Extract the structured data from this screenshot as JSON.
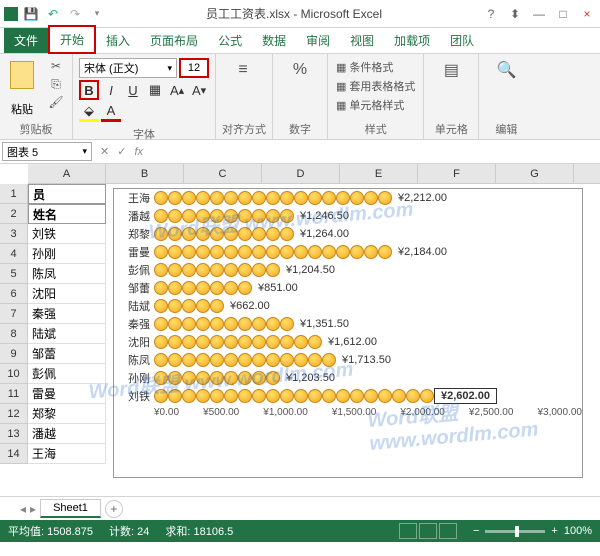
{
  "window": {
    "title": "员工工资表.xlsx - Microsoft Excel"
  },
  "tabs": {
    "file": "文件",
    "home": "开始",
    "insert": "插入",
    "page_layout": "页面布局",
    "formulas": "公式",
    "data": "数据",
    "review": "审阅",
    "view": "视图",
    "addins": "加载项",
    "team": "团队"
  },
  "ribbon": {
    "paste": "粘贴",
    "clipboard": "剪贴板",
    "font_name": "宋体 (正文)",
    "font_size": "12",
    "font_group": "字体",
    "align": "对齐方式",
    "number": "数字",
    "cond_format": "条件格式",
    "table_format": "套用表格格式",
    "cell_styles": "单元格样式",
    "styles": "样式",
    "cells": "单元格",
    "editing": "编辑"
  },
  "namebox": "图表 5",
  "columns": [
    "A",
    "B",
    "C",
    "D",
    "E",
    "F",
    "G"
  ],
  "rows_hdr": [
    "1",
    "2",
    "3",
    "4",
    "5",
    "6",
    "7",
    "8",
    "9",
    "10",
    "11",
    "12",
    "13",
    "14"
  ],
  "colA": [
    "员",
    "姓名",
    "刘铁",
    "孙刚",
    "陈凤",
    "沈阳",
    "秦强",
    "陆斌",
    "邹蕾",
    "彭佩",
    "雷曼",
    "郑黎",
    "潘越",
    "王海"
  ],
  "chart_data": {
    "type": "bar",
    "xlabel": "",
    "ylabel": "",
    "categories": [
      "王海",
      "潘越",
      "郑黎",
      "雷曼",
      "彭佩",
      "邹蕾",
      "陆斌",
      "秦强",
      "沈阳",
      "陈凤",
      "孙刚",
      "刘铁"
    ],
    "values": [
      2212.0,
      1246.5,
      1264.0,
      2184.0,
      1204.5,
      851.0,
      662.0,
      1351.5,
      1612.0,
      1713.5,
      1203.5,
      2602.0
    ],
    "labels": [
      "¥2,212.00",
      "¥1,246.50",
      "¥1,264.00",
      "¥2,184.00",
      "¥1,204.50",
      "¥851.00",
      "¥662.00",
      "¥1,351.50",
      "¥1,612.00",
      "¥1,713.50",
      "¥1,203.50",
      "¥2,602.00"
    ],
    "axis_ticks": [
      "¥0.00",
      "¥500.00",
      "¥1,000.00",
      "¥1,500.00",
      "¥2,000.00",
      "¥2,500.00",
      "¥3,000.00"
    ],
    "highlight_index": 11
  },
  "sheet": {
    "name": "Sheet1"
  },
  "status": {
    "avg_label": "平均值:",
    "avg": "1508.875",
    "count_label": "计数:",
    "count": "24",
    "sum_label": "求和:",
    "sum": "18106.5",
    "zoom": "100%"
  },
  "watermark": "Word联盟 www.wordlm.com"
}
